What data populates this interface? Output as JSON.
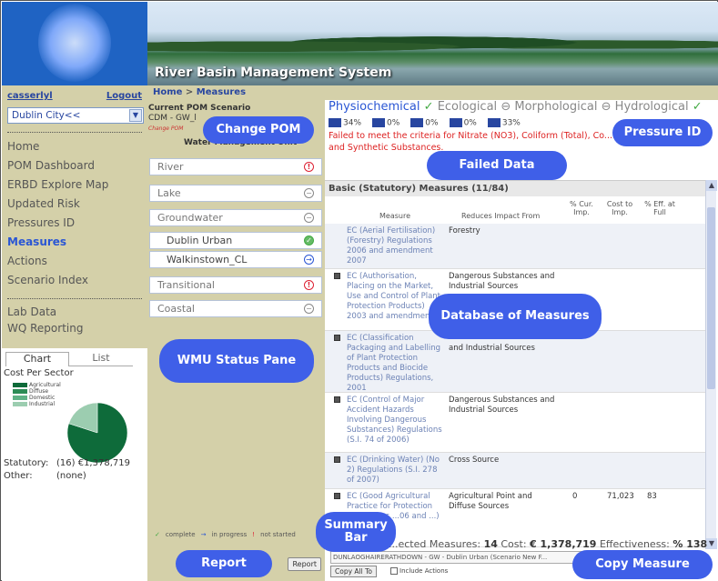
{
  "header": {
    "title": "River Basin Management System"
  },
  "user": {
    "name": "casserlyl",
    "logout": "Logout"
  },
  "city_select": {
    "value": "Dublin City<<"
  },
  "nav": {
    "items": [
      {
        "label": "Home"
      },
      {
        "label": "POM Dashboard"
      },
      {
        "label": "ERBD Explore Map"
      },
      {
        "label": "Updated Risk"
      },
      {
        "label": "Pressures ID"
      },
      {
        "label": "Measures",
        "active": true
      },
      {
        "label": "Actions"
      },
      {
        "label": "Scenario Index"
      }
    ],
    "secondary": [
      {
        "label": "Lab Data"
      },
      {
        "label": "WQ Reporting"
      }
    ]
  },
  "chart_panel": {
    "tabs": [
      "Chart",
      "List"
    ],
    "title": "Cost Per Sector",
    "legend": [
      "Agricultural",
      "Diffuse",
      "Domestic",
      "Industrial"
    ],
    "statutory_label": "Statutory:",
    "statutory_value": "(16) €1,378,719",
    "other_label": "Other:",
    "other_value": "(none)"
  },
  "chart_data": {
    "type": "pie",
    "title": "Cost Per Sector",
    "categories": [
      "Agricultural",
      "Diffuse",
      "Domestic",
      "Industrial"
    ],
    "values": [
      80,
      0,
      0,
      20
    ],
    "colors": [
      "#0e6b3a",
      "#2c8c55",
      "#5fb285",
      "#9ccdb0"
    ]
  },
  "breadcrumb": {
    "home": "Home",
    "sep": " > ",
    "current": "Measures"
  },
  "pom": {
    "heading": "Current POM Scenario",
    "scenario": "CDM - GW_l",
    "change_link": "Change POM",
    "wmu_title": "Water Management Unit"
  },
  "wmu": {
    "items": [
      {
        "label": "River",
        "status": "not-started",
        "sub": false
      },
      {
        "label": "Lake",
        "status": "none",
        "sub": false
      },
      {
        "label": "Groundwater",
        "status": "none",
        "sub": false
      },
      {
        "label": "Dublin Urban",
        "status": "complete",
        "sub": true
      },
      {
        "label": "Walkinstown_CL",
        "status": "in-progress",
        "sub": true
      },
      {
        "label": "Transitional",
        "status": "not-started",
        "sub": false
      },
      {
        "label": "Coastal",
        "status": "none",
        "sub": false
      }
    ],
    "legend_complete": "complete",
    "legend_progress": "in progress",
    "legend_notstarted": "not started",
    "report_button": "Report"
  },
  "categories": {
    "physiochemical": "Physiochemical",
    "ecological": "Ecological",
    "morphological": "Morphological",
    "hydrological": "Hydrological"
  },
  "pressures": [
    "34%",
    "0%",
    "0%",
    "0%",
    "33%",
    "0%"
  ],
  "failed_text": "Failed to meet the criteria for Nitrate (NO3), Coliform (Total), Co... and Synthetic Substances.",
  "measures": {
    "heading": "Basic (Statutory) Measures (11/84)",
    "columns": {
      "measure": "Measure",
      "reduces": "Reduces Impact From",
      "cur": "% Cur. Imp.",
      "cost": "Cost to Imp.",
      "eff": "% Eff. at Full"
    },
    "rows": [
      {
        "measure": "EC (Aerial Fertilisation) (Forestry) Regulations 2006 and amendment 2007",
        "reduces": "Forestry",
        "cur": "",
        "cost": "",
        "eff": ""
      },
      {
        "measure": "EC (Authorisation, Placing on the Market, Use and Control of Plant Protection Products) 2003 and amendments",
        "reduces": "Dangerous Substances and Industrial Sources",
        "cur": "",
        "cost": "",
        "eff": ""
      },
      {
        "measure": "EC (Classification Packaging and Labelling of Plant Protection Products and Biocide Products) Regulations, 2001",
        "reduces": "and Industrial Sources",
        "cur": "",
        "cost": "",
        "eff": ""
      },
      {
        "measure": "EC (Control of Major Accident Hazards Involving Dangerous Substances) Regulations (S.I. 74 of 2006)",
        "reduces": "Dangerous Substances and Industrial Sources",
        "cur": "",
        "cost": "",
        "eff": ""
      },
      {
        "measure": "EC (Drinking Water) (No 2) Regulations (S.I. 278 of 2007)",
        "reduces": "Cross Source",
        "cur": "",
        "cost": "",
        "eff": ""
      },
      {
        "measure": "EC (Good Agricultural Practice for Protection ...gulations ...06 and ...)",
        "reduces": "Agricultural Point and Diffuse Sources",
        "cur": "0",
        "cost": "71,023",
        "eff": "83"
      }
    ]
  },
  "summary": {
    "label": "...ected Measures:",
    "count": "14",
    "cost_label": "Cost:",
    "cost": "€ 1,378,719",
    "eff_label": "Effectiveness:",
    "eff": "% 138"
  },
  "copy": {
    "text": "DUNLAOGHAIRERATHDOWN - GW - Dublin Urban (Scenario New F...",
    "button": "Copy All To",
    "include": "Include Actions"
  },
  "callouts": {
    "change_pom": "Change POM",
    "pressure_id": "Pressure ID",
    "failed_data": "Failed Data",
    "database": "Database of Measures",
    "wmu_status": "WMU Status Pane",
    "summary_bar": "Summary Bar",
    "report": "Report",
    "copy_measure": "Copy Measure"
  }
}
